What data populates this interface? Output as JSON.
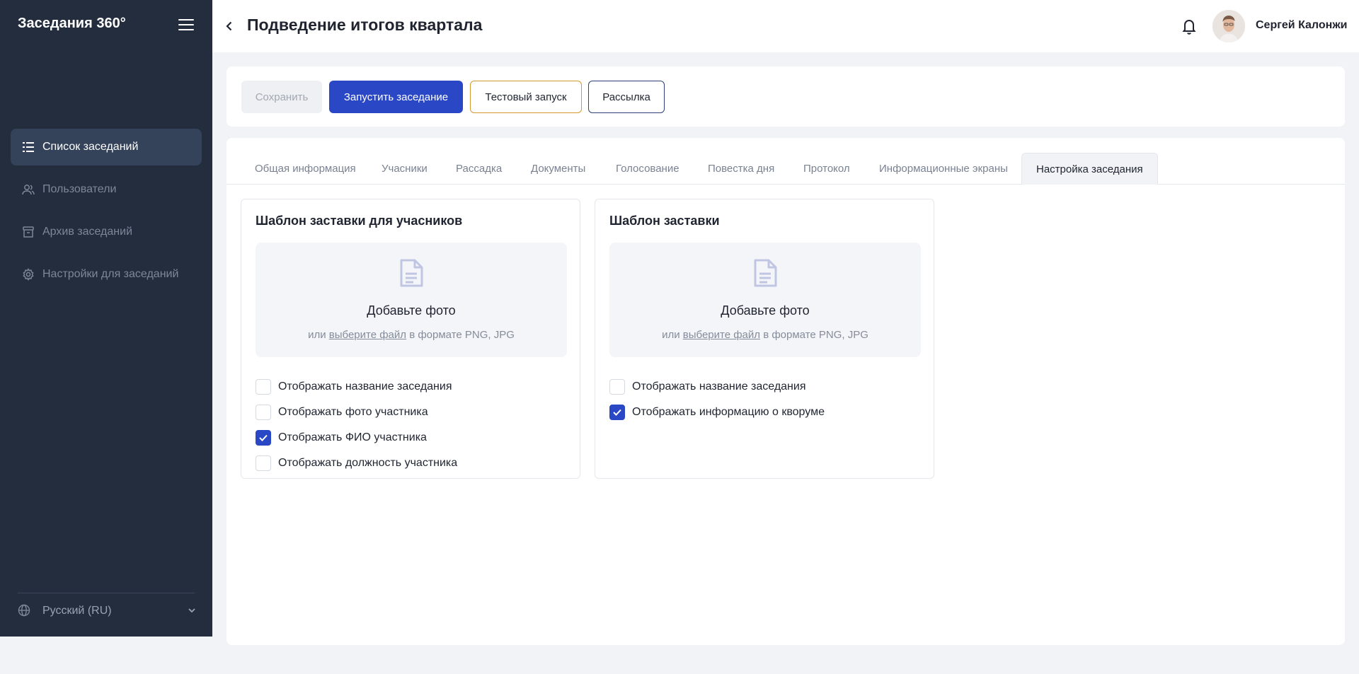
{
  "sidebar": {
    "brand": "Заседания 360°",
    "items": [
      {
        "label": "Список заседаний",
        "icon": "list-icon",
        "active": true
      },
      {
        "label": "Пользователи",
        "icon": "users-icon",
        "active": false
      },
      {
        "label": "Архив заседаний",
        "icon": "archive-icon",
        "active": false
      },
      {
        "label": "Настройки для заседаний",
        "icon": "gear-icon",
        "active": false
      }
    ],
    "language": "Русский (RU)"
  },
  "header": {
    "title": "Подведение итогов квартала",
    "user_name": "Сергей Калонжи"
  },
  "toolbar": {
    "save_label": "Сохранить",
    "start_label": "Запустить заседание",
    "test_label": "Тестовый запуск",
    "mailing_label": "Рассылка"
  },
  "tabs": [
    "Общая информация",
    "Учасники",
    "Рассадка",
    "Документы",
    "Голосование",
    "Повестка дня",
    "Протокол",
    "Информационные экраны",
    "Настройка заседания"
  ],
  "active_tab": "Настройка заседания",
  "panels": [
    {
      "title": "Шаблон заставки для учасников",
      "upload_title": "Добавьте фото",
      "upload_prefix": "или",
      "upload_link": "выберите файл",
      "upload_suffix": "в формате PNG, JPG",
      "options": [
        {
          "label": "Отображать название заседания",
          "checked": false
        },
        {
          "label": "Отображать фото участника",
          "checked": false
        },
        {
          "label": "Отображать ФИО участника",
          "checked": true
        },
        {
          "label": "Отображать должность участника",
          "checked": false
        }
      ]
    },
    {
      "title": "Шаблон заставки",
      "upload_title": "Добавьте фото",
      "upload_prefix": "или",
      "upload_link": "выберите файл",
      "upload_suffix": "в формате PNG, JPG",
      "options": [
        {
          "label": "Отображать название заседания",
          "checked": false
        },
        {
          "label": "Отображать информацию о кворуме",
          "checked": true
        }
      ]
    }
  ],
  "colors": {
    "sidebar_bg": "#232d3d",
    "sidebar_active": "#34425a",
    "primary": "#2a47c6",
    "test_border": "#d59a2f",
    "mailing_border": "#2e3f7a"
  }
}
